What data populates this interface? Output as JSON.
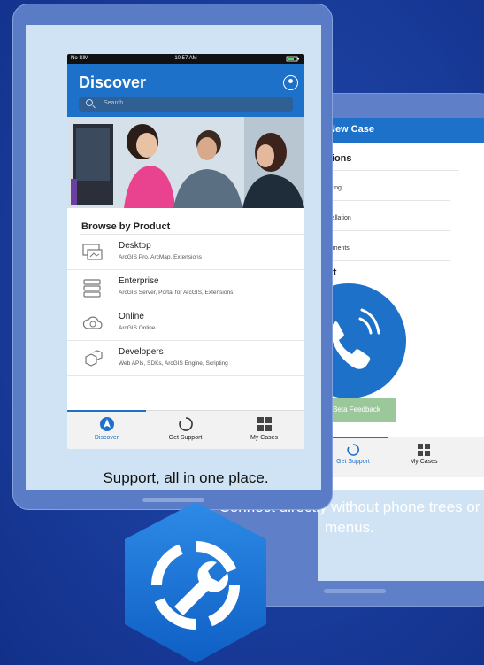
{
  "discover_phone": {
    "status": {
      "carrier": "No SIM",
      "time": "10:57 AM"
    },
    "title": "Discover",
    "search_placeholder": "Search",
    "browse_heading": "Browse by Product",
    "products": [
      {
        "name": "Desktop",
        "sub": "ArcGIS Pro, ArcMap, Extensions",
        "icon": "desktop-icon"
      },
      {
        "name": "Enterprise",
        "sub": "ArcGIS Server, Portal for ArcGIS, Extensions",
        "icon": "enterprise-server-icon"
      },
      {
        "name": "Online",
        "sub": "ArcGIS Online",
        "icon": "cloud-icon"
      },
      {
        "name": "Developers",
        "sub": "Web APIs, SDKs, ArcGIS Engine, Scripting",
        "icon": "developers-cubes-icon"
      }
    ],
    "tabs": [
      {
        "label": "Discover",
        "icon": "compass-icon",
        "active": true
      },
      {
        "label": "Get Support",
        "icon": "support-spinner-icon",
        "active": false
      },
      {
        "label": "My Cases",
        "icon": "cases-grid-icon",
        "active": false
      }
    ]
  },
  "caption_front": "Support, all in one place.",
  "case_phone": {
    "title": "New Case",
    "section1": "ections",
    "items": [
      "nfiguring",
      "r Installation",
      "eployments"
    ],
    "section2": "oort",
    "feedback_label": "Beta Feedback",
    "tabs": [
      {
        "label": "Get Support"
      },
      {
        "label": "My Cases"
      }
    ]
  },
  "caption_back": "Connect directly without phone trees or menus.",
  "colors": {
    "brand_blue": "#1e71c9",
    "background": "#163a9a",
    "tablet": "#5a7cc7"
  }
}
